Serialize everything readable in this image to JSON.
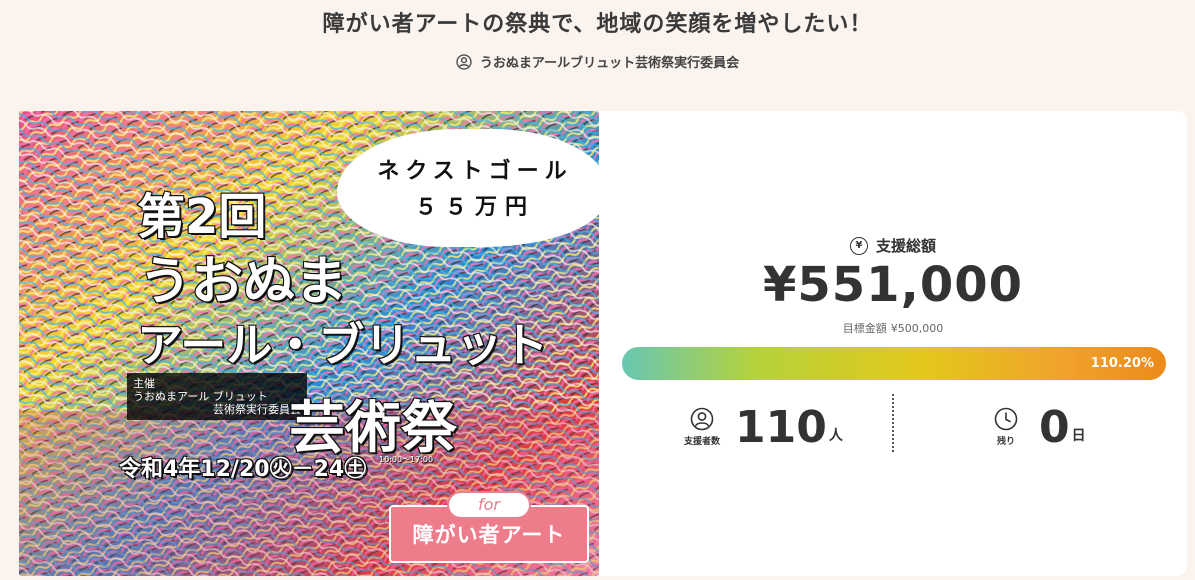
{
  "page": {
    "title": "障がい者アートの祭典で、地域の笑顔を増やしたい！",
    "owner": "うおぬまアールブリュット芸術祭実行委員会",
    "owner_icon": "user-icon"
  },
  "hero": {
    "cloud_line1": "ネクストゴール",
    "cloud_line2": "５５万円",
    "poster_dai": "第2回",
    "poster_uonuma": "うおぬま",
    "poster_art": "アール・ブリュット",
    "poster_fes": "芸術祭",
    "sponsor_line1": "主催",
    "sponsor_line2": "うおぬまアール ブリュット",
    "sponsor_line3": "芸術祭実行委員会",
    "date_line": "令和4年12/20㊋－24㊏",
    "date_note_line1": "10:00〜17:00",
    "date_note_line2": "",
    "badge_for": "for",
    "badge_main": "障がい者アート",
    "accent_color": "#ee7d8c"
  },
  "stats": {
    "total_label": "支援総額",
    "total_icon": "yen-icon",
    "total_amount": "¥551,000",
    "goal_label": "目標金額",
    "goal_amount": "¥500,000",
    "progress_percent": "110.20%",
    "progress_value": 110.2,
    "supporters_label": "支援者数",
    "supporters_icon": "user-icon",
    "supporters_count": "110",
    "supporters_unit": "人",
    "remaining_label": "残り",
    "remaining_icon": "clock-icon",
    "remaining_count": "0",
    "remaining_unit": "日"
  }
}
